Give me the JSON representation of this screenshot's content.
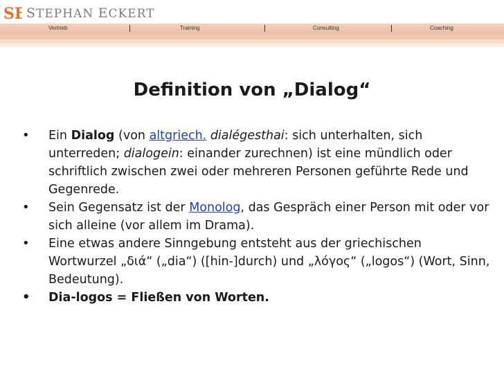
{
  "header": {
    "logo_initials": "SE",
    "logo_text_first_cap": "S",
    "logo_text_first_rest": "TEPHAN",
    "logo_text_second_cap": "E",
    "logo_text_second_rest": "CKERT",
    "colors": {
      "logo_orange": "#e9702a",
      "nav_bar": "#efc4ab",
      "logo_gray": "#7a7a7a"
    }
  },
  "nav": {
    "items": [
      {
        "label": "Vertrieb"
      },
      {
        "label": "Training"
      },
      {
        "label": "Consulting"
      },
      {
        "label": "Coaching"
      }
    ]
  },
  "slide": {
    "title": "Definition von „Dialog“",
    "b1": {
      "t1": "Ein ",
      "t2": "Dialog",
      "t3": " (von ",
      "link": "altgriech.",
      "t4": " ",
      "t5": "dialégesthai",
      "t6": ": sich unterhalten, sich unterreden; ",
      "t7": "dialogein",
      "t8": ": einander zurechnen) ist eine mündlich oder schriftlich zwischen zwei oder mehreren Personen geführte Rede und Gegenrede."
    },
    "b2": {
      "t1": "Sein Gegensatz ist der ",
      "link": "Monolog",
      "t2": ", das Gespräch einer Person mit oder vor sich alleine (vor allem im Drama)."
    },
    "b3": {
      "t1": "Eine etwas andere Sinngebung entsteht aus der griechischen Wortwurzel „διά“ („dia“) ([hin-]durch) und „λόγος“ („logos“) (Wort, Sinn, Bedeutung)."
    },
    "b4": {
      "t1": "Dia-logos = Fließen von Worten."
    }
  }
}
